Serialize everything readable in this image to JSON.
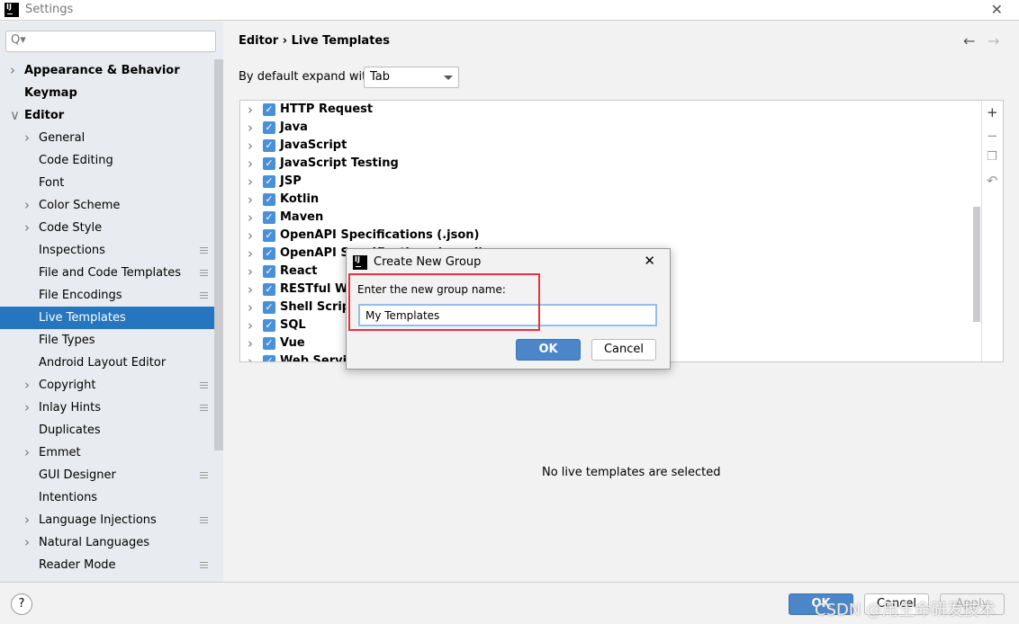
{
  "window": {
    "title": "Settings"
  },
  "sidebar": {
    "search_placeholder": "Q▾",
    "items": [
      {
        "label": "Appearance & Behavior",
        "bold": true,
        "chev": ">",
        "level": 0
      },
      {
        "label": "Keymap",
        "bold": true,
        "chev": "",
        "level": 0
      },
      {
        "label": "Editor",
        "bold": true,
        "chev": "v",
        "level": 0
      },
      {
        "label": "General",
        "chev": ">",
        "level": 1
      },
      {
        "label": "Code Editing",
        "chev": "",
        "level": 1
      },
      {
        "label": "Font",
        "chev": "",
        "level": 1
      },
      {
        "label": "Color Scheme",
        "chev": ">",
        "level": 1
      },
      {
        "label": "Code Style",
        "chev": ">",
        "level": 1
      },
      {
        "label": "Inspections",
        "chev": "",
        "level": 1,
        "mark": true
      },
      {
        "label": "File and Code Templates",
        "chev": "",
        "level": 1,
        "mark": true
      },
      {
        "label": "File Encodings",
        "chev": "",
        "level": 1,
        "mark": true
      },
      {
        "label": "Live Templates",
        "chev": "",
        "level": 1,
        "selected": true
      },
      {
        "label": "File Types",
        "chev": "",
        "level": 1
      },
      {
        "label": "Android Layout Editor",
        "chev": "",
        "level": 1
      },
      {
        "label": "Copyright",
        "chev": ">",
        "level": 1,
        "mark": true
      },
      {
        "label": "Inlay Hints",
        "chev": ">",
        "level": 1,
        "mark": true
      },
      {
        "label": "Duplicates",
        "chev": "",
        "level": 1
      },
      {
        "label": "Emmet",
        "chev": ">",
        "level": 1
      },
      {
        "label": "GUI Designer",
        "chev": "",
        "level": 1,
        "mark": true
      },
      {
        "label": "Intentions",
        "chev": "",
        "level": 1
      },
      {
        "label": "Language Injections",
        "chev": ">",
        "level": 1,
        "mark": true
      },
      {
        "label": "Natural Languages",
        "chev": ">",
        "level": 1
      },
      {
        "label": "Reader Mode",
        "chev": "",
        "level": 1,
        "mark": true
      }
    ]
  },
  "header": {
    "breadcrumb": "Editor  ›  Live Templates",
    "back": "←",
    "forward": "→"
  },
  "expand": {
    "label": "By default expand with",
    "value": "Tab"
  },
  "templates": {
    "groups": [
      "HTTP Request",
      "Java",
      "JavaScript",
      "JavaScript Testing",
      "JSP",
      "Kotlin",
      "Maven",
      "OpenAPI Specifications (.json)",
      "OpenAPI Specifications (.yaml)",
      "React",
      "RESTful Web Services",
      "Shell Script",
      "SQL",
      "Vue",
      "Web Services"
    ],
    "checked": true,
    "tools": {
      "add": "+",
      "remove": "−",
      "copy": "❐",
      "revert": "↶"
    }
  },
  "empty_text": "No live templates are selected",
  "dialog": {
    "title": "Create New Group",
    "prompt": "Enter the new group name:",
    "value": "My Templates",
    "ok": "OK",
    "cancel": "Cancel",
    "close": "✕"
  },
  "footer": {
    "help": "?",
    "ok": "OK",
    "cancel": "Cancel",
    "apply": "Apply"
  },
  "watermark": "CSDN @用生命研发技术",
  "colors": {
    "accent": "#2675bf",
    "primary_button": "#4a86c8",
    "highlight": "#e8323c"
  }
}
